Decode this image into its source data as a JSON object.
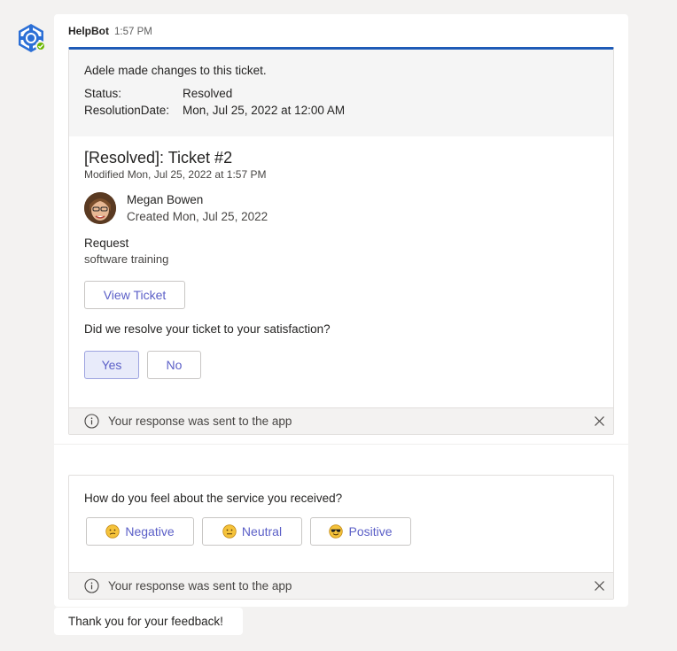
{
  "bot": {
    "name": "HelpBot",
    "time": "1:57 PM",
    "avatar_icon": "bot-logo-icon",
    "presence": "available"
  },
  "card1": {
    "changes_title": "Adele made changes to this ticket.",
    "facts": [
      {
        "key": "Status:",
        "value": "Resolved"
      },
      {
        "key": "ResolutionDate:",
        "value": "Mon, Jul 25, 2022 at 12:00 AM"
      }
    ],
    "ticket_title": "[Resolved]: Ticket #2",
    "modified": "Modified Mon, Jul 25, 2022 at 1:57 PM",
    "person_name": "Megan Bowen",
    "person_created": "Created Mon, Jul 25, 2022",
    "request_label": "Request",
    "request_value": "software training",
    "view_button": "View Ticket",
    "question": "Did we resolve your ticket to your satisfaction?",
    "yes_button": "Yes",
    "no_button": "No",
    "response_text": "Your response was sent to the app"
  },
  "card2": {
    "question": "How do you feel about the service you received?",
    "buttons": [
      {
        "label": "Negative",
        "icon": "confused-face-icon"
      },
      {
        "label": "Neutral",
        "icon": "neutral-face-icon"
      },
      {
        "label": "Positive",
        "icon": "sunglasses-face-icon"
      }
    ],
    "response_text": "Your response was sent to the app"
  },
  "thanks": "Thank you for your feedback!",
  "colors": {
    "accent": "#5b5fc7",
    "card_top": "#1f5bb7",
    "presence": "#6bb700"
  }
}
